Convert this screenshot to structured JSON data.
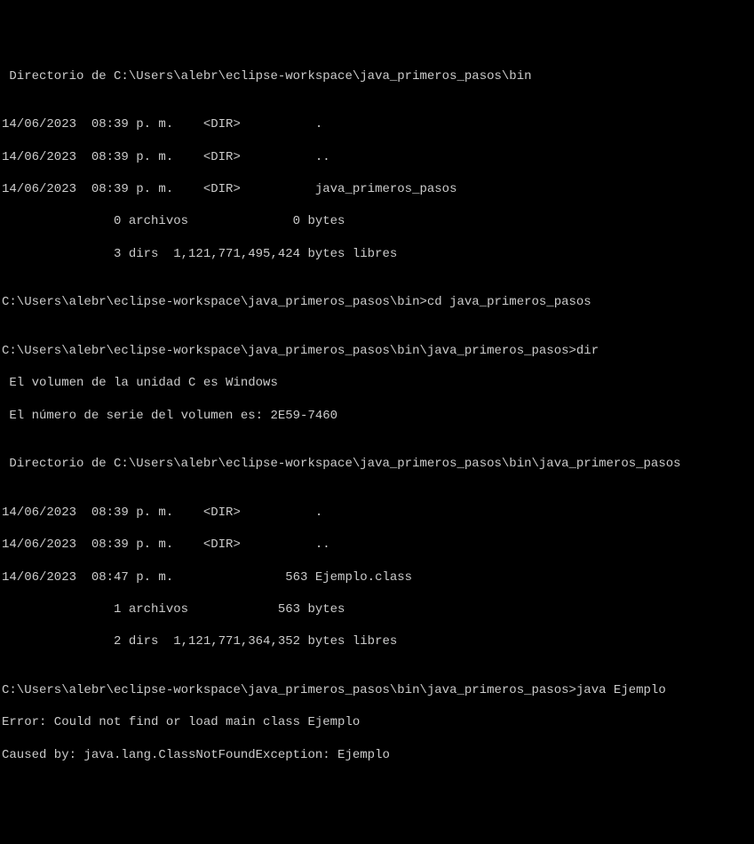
{
  "lines": {
    "l01": " Directorio de C:\\Users\\alebr\\eclipse-workspace\\java_primeros_pasos\\bin",
    "l02": "",
    "l03": "14/06/2023  08:39 p. m.    <DIR>          .",
    "l04": "14/06/2023  08:39 p. m.    <DIR>          ..",
    "l05": "14/06/2023  08:39 p. m.    <DIR>          java_primeros_pasos",
    "l06": "               0 archivos              0 bytes",
    "l07": "               3 dirs  1,121,771,495,424 bytes libres",
    "l08": "",
    "l09": "C:\\Users\\alebr\\eclipse-workspace\\java_primeros_pasos\\bin>cd java_primeros_pasos",
    "l10": "",
    "l11": "C:\\Users\\alebr\\eclipse-workspace\\java_primeros_pasos\\bin\\java_primeros_pasos>dir",
    "l12": " El volumen de la unidad C es Windows",
    "l13": " El número de serie del volumen es: 2E59-7460",
    "l14": "",
    "l15": " Directorio de C:\\Users\\alebr\\eclipse-workspace\\java_primeros_pasos\\bin\\java_primeros_pasos",
    "l16": "",
    "l17": "14/06/2023  08:39 p. m.    <DIR>          .",
    "l18": "14/06/2023  08:39 p. m.    <DIR>          ..",
    "l19": "14/06/2023  08:47 p. m.               563 Ejemplo.class",
    "l20": "               1 archivos            563 bytes",
    "l21": "               2 dirs  1,121,771,364,352 bytes libres",
    "l22": "",
    "l23": "C:\\Users\\alebr\\eclipse-workspace\\java_primeros_pasos\\bin\\java_primeros_pasos>java Ejemplo",
    "l24": "Error: Could not find or load main class Ejemplo",
    "l25": "Caused by: java.lang.ClassNotFoundException: Ejemplo"
  }
}
